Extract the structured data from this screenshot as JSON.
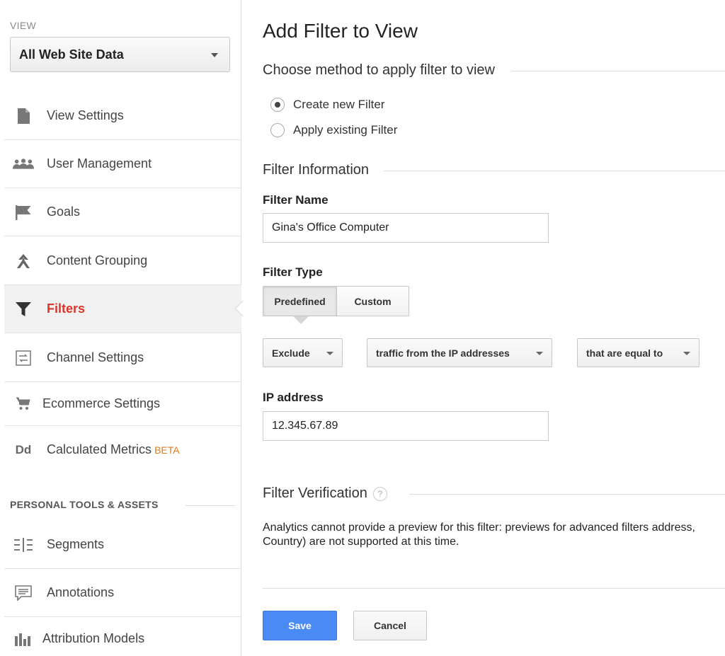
{
  "sidebar": {
    "view_label": "VIEW",
    "view_selected": "All Web Site Data",
    "items": [
      {
        "label": "View Settings",
        "icon": "document-icon"
      },
      {
        "label": "User Management",
        "icon": "users-icon"
      },
      {
        "label": "Goals",
        "icon": "flag-icon"
      },
      {
        "label": "Content Grouping",
        "icon": "content-grouping-icon"
      },
      {
        "label": "Filters",
        "icon": "filter-icon"
      },
      {
        "label": "Channel Settings",
        "icon": "channel-settings-icon"
      },
      {
        "label": "Ecommerce Settings",
        "icon": "cart-icon"
      },
      {
        "label": "Calculated Metrics",
        "badge": "BETA",
        "icon": "calculated-metrics-icon",
        "icon_text": "Dd"
      }
    ],
    "section_label": "PERSONAL TOOLS & ASSETS",
    "tools": [
      {
        "label": "Segments",
        "icon": "segments-icon"
      },
      {
        "label": "Annotations",
        "icon": "annotations-icon"
      },
      {
        "label": "Attribution Models",
        "icon": "attribution-models-icon"
      }
    ],
    "active_item": "Filters"
  },
  "main": {
    "title": "Add Filter to View",
    "method_heading": "Choose method to apply filter to view",
    "method_options": [
      {
        "label": "Create new Filter",
        "checked": true
      },
      {
        "label": "Apply existing Filter",
        "checked": false
      }
    ],
    "info_heading": "Filter Information",
    "filter_name_label": "Filter Name",
    "filter_name_value": "Gina's Office Computer",
    "filter_type_label": "Filter Type",
    "filter_type_tabs": [
      "Predefined",
      "Custom"
    ],
    "filter_type_selected": "Predefined",
    "dropdowns": {
      "action": "Exclude",
      "source": "traffic from the IP addresses",
      "expression": "that are equal to"
    },
    "ip_label": "IP address",
    "ip_value": "12.345.67.89",
    "verify_heading": "Filter Verification",
    "verify_help": "?",
    "verify_text": "Analytics cannot provide a preview for this filter: previews for advanced filters address, Country) are not supported at this time.",
    "save_label": "Save",
    "cancel_label": "Cancel"
  },
  "colors": {
    "active_nav": "#d9372b",
    "beta": "#e07a1b",
    "save_button": "#4a8af4"
  }
}
